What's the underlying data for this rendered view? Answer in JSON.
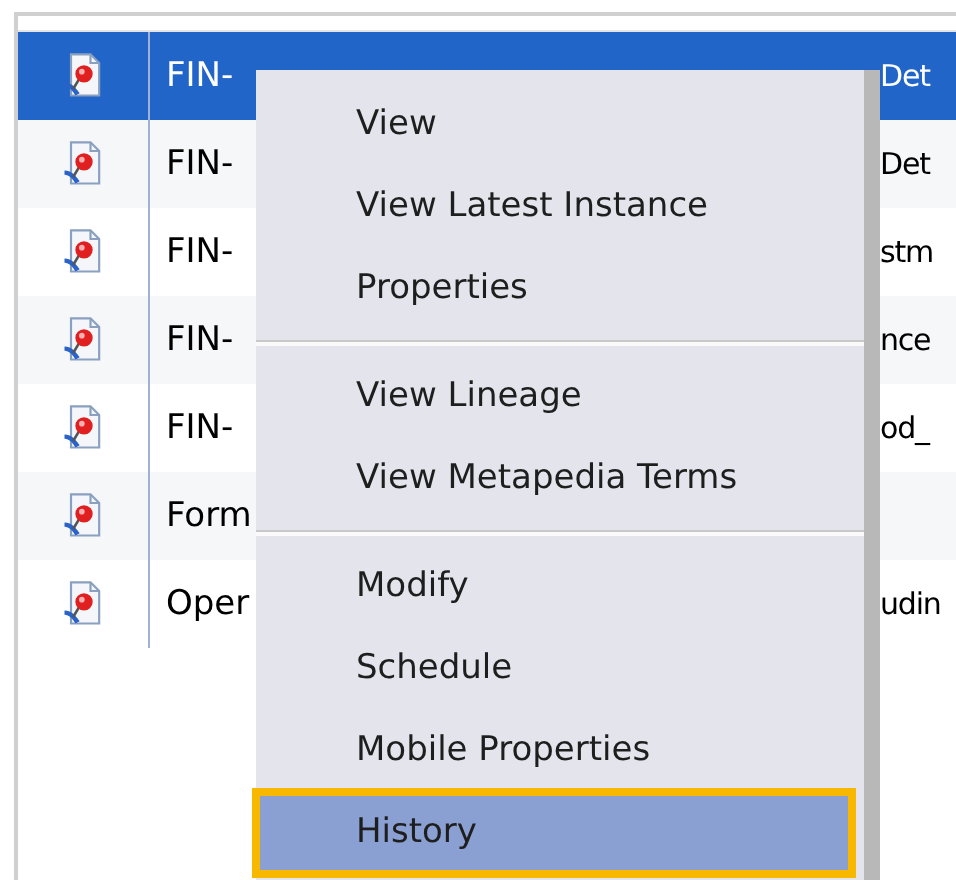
{
  "rows": [
    {
      "name": "FIN-",
      "detail": "Det",
      "selected": true
    },
    {
      "name": "FIN-",
      "detail": "Det",
      "selected": false
    },
    {
      "name": "FIN-",
      "detail": "stm",
      "selected": false
    },
    {
      "name": "FIN-",
      "detail": "nce",
      "selected": false
    },
    {
      "name": "FIN-",
      "detail": "od_",
      "selected": false
    },
    {
      "name": "Form",
      "detail": "",
      "selected": false
    },
    {
      "name": "Oper",
      "detail": "udin",
      "selected": false
    }
  ],
  "context_menu": [
    {
      "kind": "item",
      "label": "View",
      "selected": false
    },
    {
      "kind": "item",
      "label": "View Latest Instance",
      "selected": false
    },
    {
      "kind": "item",
      "label": "Properties",
      "selected": false
    },
    {
      "kind": "separator"
    },
    {
      "kind": "item",
      "label": "View Lineage",
      "selected": false
    },
    {
      "kind": "item",
      "label": "View Metapedia Terms",
      "selected": false
    },
    {
      "kind": "separator"
    },
    {
      "kind": "item",
      "label": "Modify",
      "selected": false
    },
    {
      "kind": "item",
      "label": "Schedule",
      "selected": false
    },
    {
      "kind": "item",
      "label": "Mobile Properties",
      "selected": false
    },
    {
      "kind": "item",
      "label": "History",
      "selected": true
    }
  ]
}
